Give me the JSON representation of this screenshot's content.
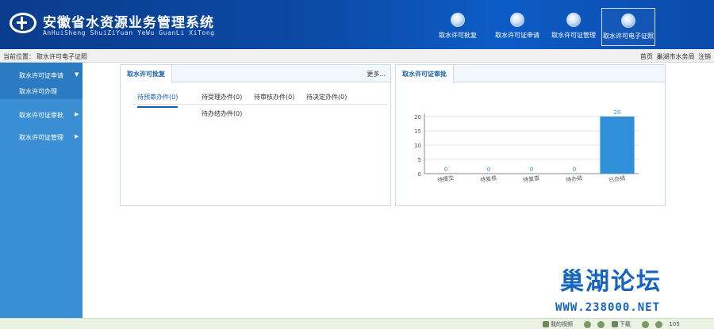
{
  "header": {
    "title": "安徽省水资源业务管理系统",
    "subtitle": "AnHuiSheng ShuiZiYuan YeWu GuanLi XiTong",
    "nav": [
      {
        "label": "取水许可批复",
        "icon": "water-approval-icon"
      },
      {
        "label": "取水许可证申请",
        "icon": "license-apply-icon"
      },
      {
        "label": "取水许可证管理",
        "icon": "license-manage-icon"
      },
      {
        "label": "取水许可电子证照",
        "icon": "e-license-icon"
      }
    ]
  },
  "breadcrumb": {
    "label": "当前位置：",
    "value": "取水许可电子证照"
  },
  "top_links": {
    "home": "首页",
    "org": "巢湖市水务局",
    "logout": "注销"
  },
  "sidebar": {
    "items": [
      {
        "label": "取水许可证申请",
        "sub": "取水许可办理"
      },
      {
        "label": "取水许可证审批"
      },
      {
        "label": "取水许可证管理"
      }
    ]
  },
  "left_panel": {
    "tab": "取水许可批复",
    "more": "更多...",
    "subtabs": [
      "待预审办件(0)",
      "待受理办件(0)",
      "待审核办件(0)",
      "待决定办件(0)",
      "待办结办件(0)"
    ]
  },
  "right_panel": {
    "tab": "取水许可证审批"
  },
  "chart_data": {
    "type": "bar",
    "categories": [
      "待提交",
      "待复核",
      "待复查",
      "待办结",
      "已办结"
    ],
    "values": [
      0,
      0,
      0,
      0,
      20
    ],
    "ylim": [
      0,
      20
    ],
    "yticks": [
      0,
      5,
      10,
      15,
      20
    ],
    "bar_color": "#2f8fd8"
  },
  "watermark": {
    "title": "巢湖论坛",
    "url": "WWW.238000.NET"
  },
  "statusbar": {
    "video": "我的视频",
    "download": "下载",
    "zoom": "105"
  }
}
